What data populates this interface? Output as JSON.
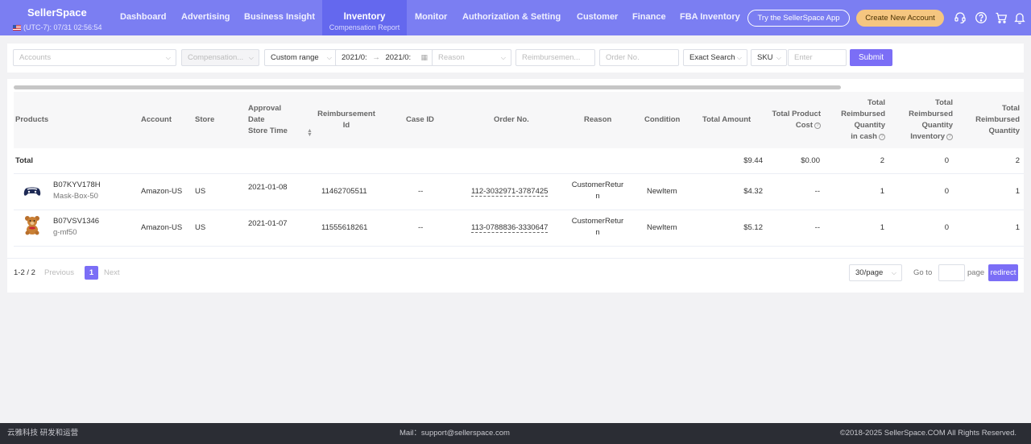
{
  "header": {
    "logo": "SellerSpace",
    "timezone": "(UTC-7): 07/31 02:56:54",
    "nav": [
      {
        "label": "Dashboard"
      },
      {
        "label": "Advertising"
      },
      {
        "label": "Business Insight"
      },
      {
        "label": "Inventory",
        "sub": "Compensation Report",
        "active": true
      },
      {
        "label": "Monitor"
      },
      {
        "label": "Authorization & Setting"
      },
      {
        "label": "Customer"
      },
      {
        "label": "Finance"
      },
      {
        "label": "FBA Inventory"
      }
    ],
    "try_app": "Try the SellerSpace App",
    "create_account": "Create New Account",
    "icons": [
      "support-icon",
      "help-icon",
      "cart-icon",
      "bell-icon"
    ]
  },
  "filters": {
    "accounts_placeholder": "Accounts",
    "compensation_placeholder": "Compensation...",
    "range_label": "Custom range",
    "date_start": "2021/0:",
    "date_sep": "→",
    "date_end": "2021/0:",
    "reason_placeholder": "Reason",
    "reimbursement_placeholder": "Reimbursemen...",
    "order_placeholder": "Order No.",
    "match_mode": "Exact Search",
    "field": "SKU",
    "enter_placeholder": "Enter",
    "submit": "Submit"
  },
  "table": {
    "headers": {
      "products": "Products",
      "account": "Account",
      "store": "Store",
      "approval_1": "Approval",
      "approval_2": "Date",
      "approval_3": "Store Time",
      "reimb_1": "Reimbursement",
      "reimb_2": "Id",
      "case_id": "Case ID",
      "order_no": "Order No.",
      "reason": "Reason",
      "condition": "Condition",
      "total_amount": "Total Amount",
      "tpc_1": "Total Product",
      "tpc_2": "Cost",
      "cash_1": "Total",
      "cash_2": "Reimbursed",
      "cash_3": "Quantity",
      "cash_4": "in cash",
      "inv_1": "Total",
      "inv_2": "Reimbursed",
      "inv_3": "Quantity",
      "inv_4": "Inventory",
      "tq_1": "Total",
      "tq_2": "Reimbursed",
      "tq_3": "Quantity"
    },
    "total": {
      "label": "Total",
      "amount": "$9.44",
      "product_cost": "$0.00",
      "qty_cash": "2",
      "qty_inventory": "0",
      "qty_total": "2"
    },
    "rows": [
      {
        "asin": "B07KYV178H",
        "sku": "Mask-Box-50",
        "image": "gamepad-icon",
        "account": "Amazon-US",
        "store": "US",
        "date": "2021-01-08",
        "reimbursement_id": "11462705511",
        "case_id": "--",
        "order_no": "112-3032971-3787425",
        "reason_1": "CustomerRetur",
        "reason_2": "n",
        "condition": "NewItem",
        "amount": "$4.32",
        "product_cost": "--",
        "qty_cash": "1",
        "qty_inventory": "0",
        "qty_total": "1"
      },
      {
        "asin": "B07VSV1346",
        "sku": "g-mf50",
        "image": "teddy-bear-icon",
        "account": "Amazon-US",
        "store": "US",
        "date": "2021-01-07",
        "reimbursement_id": "11555618261",
        "case_id": "--",
        "order_no": "113-0788836-3330647",
        "reason_1": "CustomerRetur",
        "reason_2": "n",
        "condition": "NewItem",
        "amount": "$5.12",
        "product_cost": "--",
        "qty_cash": "1",
        "qty_inventory": "0",
        "qty_total": "1"
      }
    ]
  },
  "pagination": {
    "range": "1-2",
    "sep": " / ",
    "total": "2",
    "previous": "Previous",
    "current": "1",
    "next": "Next",
    "page_size": "30/page",
    "goto_label": "Go to",
    "page_label": "page",
    "redirect": "redirect"
  },
  "footer": {
    "left": "云雅科技 研发和运营",
    "mail": "Mail：support@sellerspace.com",
    "copyright": "©2018-2025 SellerSpace.COM All Rights Reserved."
  }
}
